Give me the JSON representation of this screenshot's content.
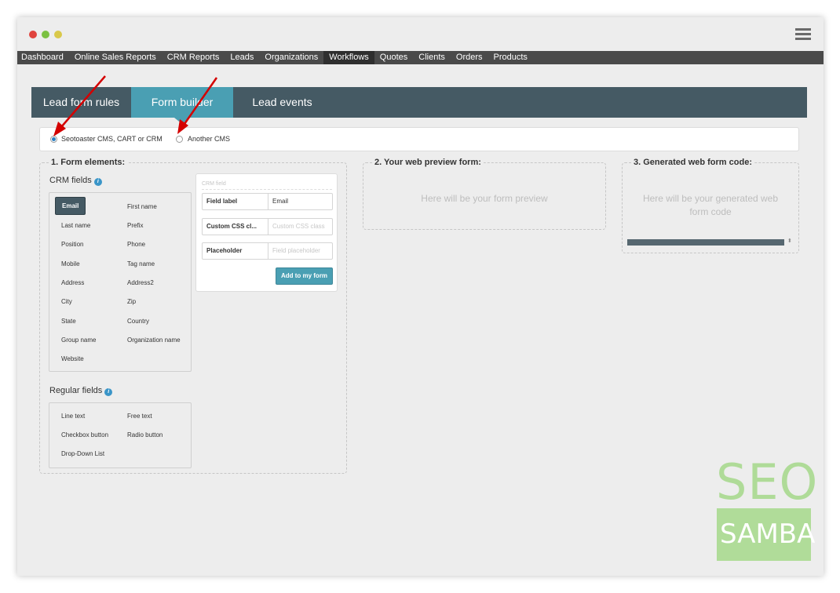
{
  "nav": {
    "items": [
      "Dashboard",
      "Online Sales Reports",
      "CRM Reports",
      "Leads",
      "Organizations",
      "Workflows",
      "Quotes",
      "Clients",
      "Orders",
      "Products"
    ],
    "active_index": 5
  },
  "tabs": {
    "lead_form_rules": "Lead form rules",
    "form_builder": "Form builder",
    "lead_events": "Lead events",
    "active": "form_builder"
  },
  "cms_options": {
    "option1": "Seotoaster CMS, CART or CRM",
    "option2": "Another CMS",
    "selected": "option1"
  },
  "form_elements": {
    "title": "1. Form elements:",
    "crm_fields_label": "CRM fields",
    "info_glyph": "i",
    "crm_fields": [
      "Email",
      "First name",
      "Last name",
      "Prefix",
      "Position",
      "Phone",
      "Mobile",
      "Tag name",
      "Address",
      "Address2",
      "City",
      "Zip",
      "State",
      "Country",
      "Group name",
      "Organization name",
      "Website"
    ],
    "selected_field": "Email",
    "regular_fields_label": "Regular fields",
    "regular_fields": [
      "Line text",
      "Free text",
      "Checkbox button",
      "Radio button",
      "Drop-Down List"
    ]
  },
  "crm_field_editor": {
    "title": "CRM field",
    "field_label": "Field label",
    "field_label_value": "Email",
    "custom_css_label": "Custom CSS cl...",
    "custom_css_placeholder": "Custom CSS class",
    "placeholder_label": "Placeholder",
    "placeholder_placeholder": "Field placeholder",
    "add_button": "Add to my form"
  },
  "preview": {
    "title": "2. Your web preview form:",
    "placeholder": "Here will be your form preview"
  },
  "generated": {
    "title": "3. Generated web form code:",
    "placeholder": "Here will be your generated web form code",
    "arrows_glyph": "⬍"
  },
  "logo": {
    "top": "SEO",
    "bottom": "SAMBA"
  },
  "colors": {
    "tab_bar": "#455a64",
    "active_tab": "#4a9fb3",
    "nav_bar": "#4a4a4a",
    "annotation_arrow": "#d40000",
    "logo_green": "#a5d88a"
  }
}
